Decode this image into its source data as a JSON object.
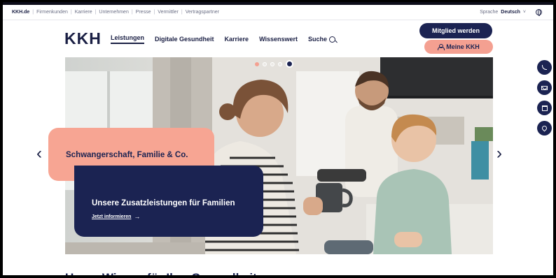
{
  "utility_bar": {
    "links": [
      "KKH.de",
      "Firmenkunden",
      "Karriere",
      "Unternehmen",
      "Presse",
      "Vermittler",
      "Vertragspartner"
    ],
    "language_label": "Sprache",
    "language_value": "Deutsch",
    "language_chevron": "˅"
  },
  "header": {
    "logo": "KKH",
    "nav": {
      "leistungen": "Leistungen",
      "digitale_gesundheit": "Digitale Gesundheit",
      "karriere": "Karriere",
      "wissenswert": "Wissenswert",
      "suche": "Suche"
    },
    "join_button": "Mitglied werden",
    "meine_kkh_button": "Meine KKH"
  },
  "hero": {
    "slide_count": 5,
    "active_slide": 5,
    "category_title": "Schwangerschaft, Familie & Co.",
    "headline": "Unsere Zusatzleistungen für Familien",
    "cta": "Jetzt informieren",
    "cta_arrow": "→",
    "prev_arrow": "‹",
    "next_arrow": "›"
  },
  "side_actions": [
    "phone-icon",
    "mail-icon",
    "calendar-icon",
    "location-pin-icon"
  ],
  "section_peek": "Unser Wissen für Ihre Gesundheit",
  "colors": {
    "navy": "#1b2352",
    "salmon": "#f7a593",
    "text_dark": "#1a1f44"
  }
}
